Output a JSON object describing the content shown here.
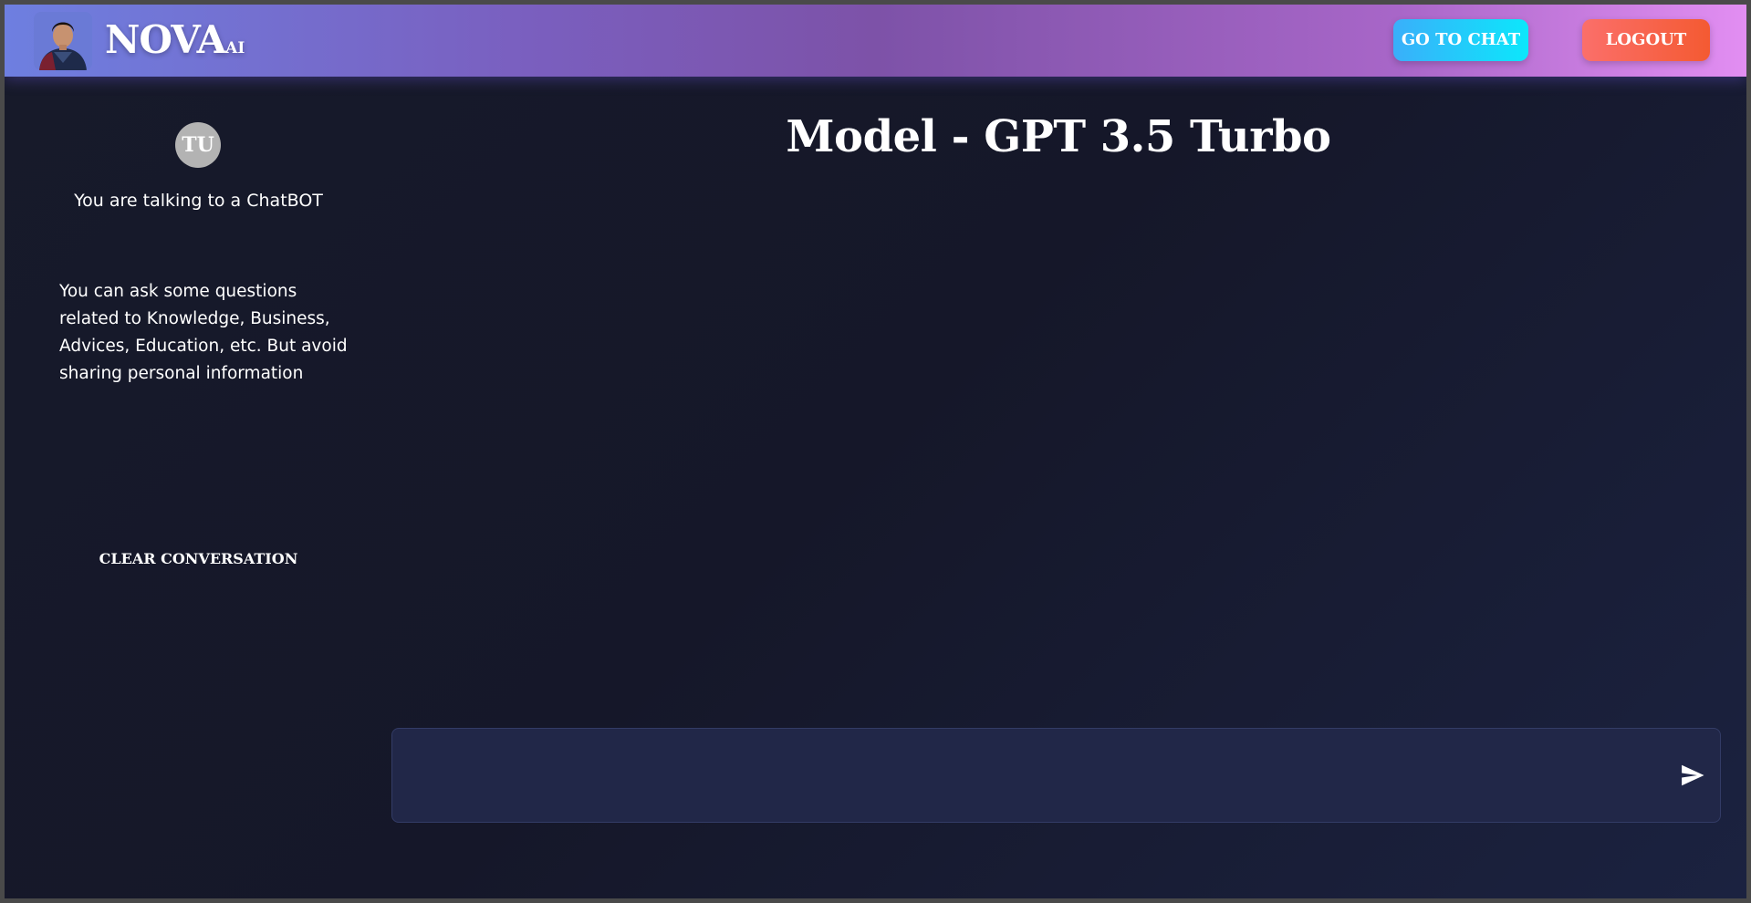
{
  "header": {
    "brand_name": "NOVA",
    "brand_sub": "AI",
    "go_to_chat_label": "GO TO CHAT",
    "logout_label": "LOGOUT"
  },
  "sidebar": {
    "user_initials": "TU",
    "talking_text": "You are talking to a ChatBOT",
    "info_text": "You can ask some questions related to Knowledge, Business, Advices, Education, etc. But avoid sharing personal information",
    "clear_label": "CLEAR CONVERSATION"
  },
  "main": {
    "model_title": "Model - GPT 3.5 Turbo",
    "input_value": "",
    "send_icon": "send-icon"
  },
  "colors": {
    "go_to_chat_accent": "#0ce7fb",
    "logout_accent": "#f45a32",
    "background": "#171a2a"
  }
}
